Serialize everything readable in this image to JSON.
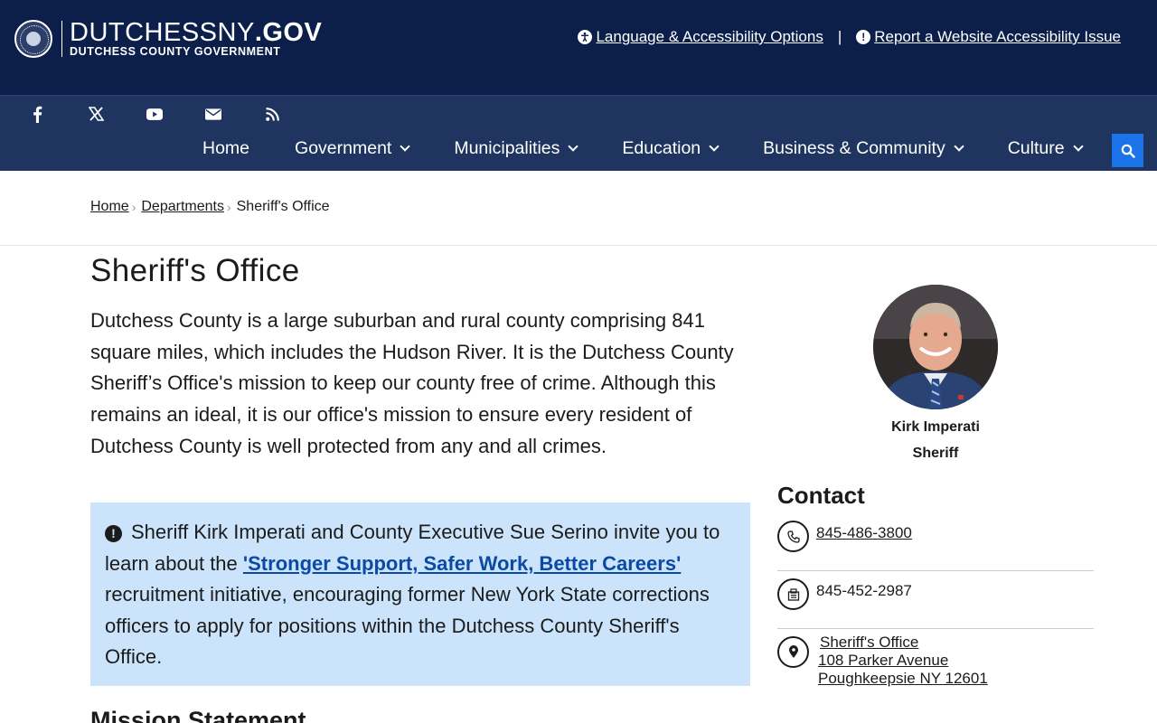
{
  "header": {
    "logo_main": "DUTCHESSNY",
    "logo_suffix": ".GOV",
    "logo_sub": "DUTCHESS COUNTY GOVERNMENT",
    "language_link": "Language & Accessibility Options",
    "separator": "|",
    "report_link": "Report a Website Accessibility Issue"
  },
  "social": [
    "facebook-icon",
    "x-twitter-icon",
    "youtube-icon",
    "email-icon",
    "rss-icon"
  ],
  "nav": {
    "items": [
      {
        "label": "Home"
      },
      {
        "label": "Government"
      },
      {
        "label": "Municipalities"
      },
      {
        "label": "Education"
      },
      {
        "label": "Business & Community"
      },
      {
        "label": "Culture"
      }
    ]
  },
  "breadcrumb": {
    "home": "Home",
    "departments": "Departments",
    "current": "Sheriff's Office"
  },
  "main": {
    "title": "Sheriff's Office",
    "intro": "Dutchess County is a large suburban and rural county comprising 841 square miles, which includes the Hudson River. It is the Dutchess County Sheriff’s Office's mission to keep our county free of crime. Although this remains an ideal, it is our office's mission to ensure every resident of Dutchess County is well protected from any and all crimes.",
    "alert_before": "Sheriff Kirk Imperati and County Executive Sue Serino invite you to learn about the ",
    "alert_link": "'Stronger Support, Safer Work, Better Careers'",
    "alert_after": " recruitment initiative, encouraging former New York State corrections officers to apply for positions within the Dutchess County Sheriff's Office.",
    "mission_heading": "Mission Statement"
  },
  "sidebar": {
    "name": "Kirk Imperati",
    "role": "Sheriff",
    "contact_heading": "Contact",
    "phone": "845-486-3800",
    "fax": "845-452-2987",
    "address_name": "Sheriff's Office",
    "address_line1": "108 Parker Avenue",
    "address_line2": "Poughkeepsie NY 12601"
  },
  "colors": {
    "header_bg": "#0b1f4a",
    "nav_bg": "#1f3560",
    "search_btn": "#1a73e8",
    "alert_bg": "#cce4fb",
    "alert_link": "#0a4aa6"
  }
}
